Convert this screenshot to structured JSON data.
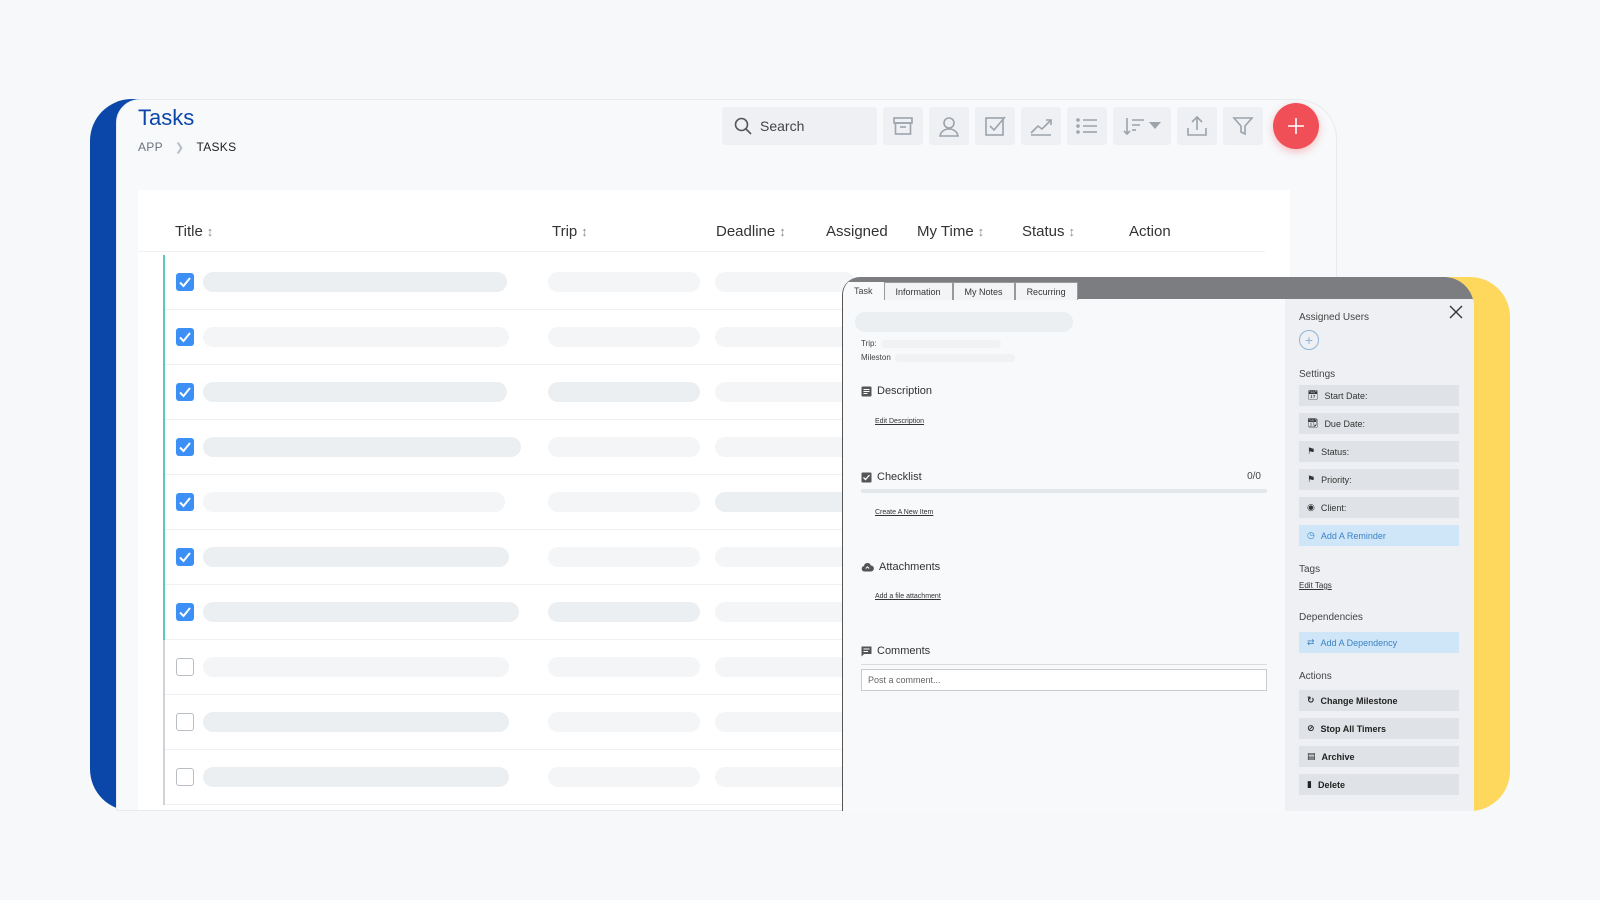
{
  "header": {
    "title": "Tasks",
    "breadcrumb": [
      "APP",
      "TASKS"
    ]
  },
  "search": {
    "placeholder": "Search"
  },
  "toolbar": {
    "icons": [
      "archive-icon",
      "user-icon",
      "checkbox-icon",
      "trend-icon",
      "list-icon",
      "sort-icon",
      "upload-icon",
      "filter-icon",
      "plus-icon"
    ]
  },
  "table": {
    "columns": [
      {
        "label": "Title",
        "sort": "↕"
      },
      {
        "label": "Trip",
        "sort": "↕"
      },
      {
        "label": "Deadline",
        "sort": "↕"
      },
      {
        "label": "Assigned",
        "sort": ""
      },
      {
        "label": "My Time",
        "sort": "↕"
      },
      {
        "label": "Status",
        "sort": "↕"
      },
      {
        "label": "Action",
        "sort": ""
      }
    ],
    "rows_checked": [
      true,
      true,
      true,
      true,
      true,
      true,
      true,
      false,
      false,
      false
    ]
  },
  "detail": {
    "tabs": [
      "Task",
      "Information",
      "My Notes",
      "Recurring"
    ],
    "trip_label": "Trip:",
    "milestone_label": "Mileston",
    "description": {
      "title": "Description",
      "link": "Edit Description"
    },
    "checklist": {
      "title": "Checklist",
      "count": "0/0",
      "link": "Create A New Item"
    },
    "attachments": {
      "title": "Attachments",
      "link": "Add a file attachment"
    },
    "comments": {
      "title": "Comments",
      "placeholder": "Post a comment..."
    },
    "sidebar": {
      "assigned_users": "Assigned Users",
      "settings": "Settings",
      "start_date": "Start Date:",
      "due_date": "Due Date:",
      "status": "Status:",
      "priority": "Priority:",
      "client": "Client:",
      "add_reminder": "Add A Reminder",
      "tags": "Tags",
      "edit_tags": "Edit Tags",
      "dependencies": "Dependencies",
      "add_dependency": "Add A Dependency",
      "actions": "Actions",
      "change_milestone": "Change Milestone",
      "stop_all_timers": "Stop All Timers",
      "archive": "Archive",
      "delete": "Delete"
    }
  },
  "colors": {
    "brand_blue": "#0a47a9",
    "accent_yellow": "#fdd85c",
    "fab_red": "#f04f58",
    "check_blue": "#3b8ff5",
    "stripe_green": "#5cc9b6"
  }
}
